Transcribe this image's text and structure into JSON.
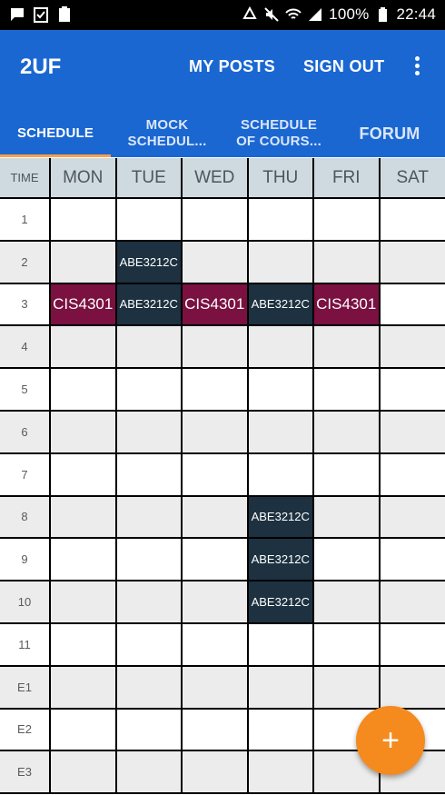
{
  "statusbar": {
    "battery_text": "100%",
    "time": "22:44",
    "left_icons": [
      "chat-icon",
      "clipboard-check-icon",
      "battery-saver-icon"
    ],
    "right_icons": [
      "recycle-icon",
      "mute-icon",
      "wifi-icon",
      "signal-icon",
      "battery-icon"
    ]
  },
  "appbar": {
    "title": "2UF",
    "my_posts": "MY POSTS",
    "sign_out": "SIGN OUT",
    "color": "#1a67d2"
  },
  "tabs": [
    {
      "label": "SCHEDULE",
      "active": true
    },
    {
      "label": "MOCK\nSCHEDUL...",
      "active": false
    },
    {
      "label": "SCHEDULE\nOF COURS...",
      "active": false
    },
    {
      "label": "FORUM",
      "active": false
    }
  ],
  "schedule": {
    "header": [
      "TIME",
      "MON",
      "TUE",
      "WED",
      "THU",
      "FRI",
      "SAT"
    ],
    "rows": [
      {
        "time": "1",
        "cells": [
          "",
          "",
          "",
          "",
          "",
          ""
        ]
      },
      {
        "time": "2",
        "cells": [
          "",
          "ABE3212C",
          "",
          "",
          "",
          ""
        ]
      },
      {
        "time": "3",
        "cells": [
          "CIS4301",
          "ABE3212C",
          "CIS4301",
          "ABE3212C",
          "CIS4301",
          ""
        ]
      },
      {
        "time": "4",
        "cells": [
          "",
          "",
          "",
          "",
          "",
          ""
        ]
      },
      {
        "time": "5",
        "cells": [
          "",
          "",
          "",
          "",
          "",
          ""
        ]
      },
      {
        "time": "6",
        "cells": [
          "",
          "",
          "",
          "",
          "",
          ""
        ]
      },
      {
        "time": "7",
        "cells": [
          "",
          "",
          "",
          "",
          "",
          ""
        ]
      },
      {
        "time": "8",
        "cells": [
          "",
          "",
          "",
          "ABE3212C",
          "",
          ""
        ]
      },
      {
        "time": "9",
        "cells": [
          "",
          "",
          "",
          "ABE3212C",
          "",
          ""
        ]
      },
      {
        "time": "10",
        "cells": [
          "",
          "",
          "",
          "ABE3212C",
          "",
          ""
        ]
      },
      {
        "time": "11",
        "cells": [
          "",
          "",
          "",
          "",
          "",
          ""
        ]
      },
      {
        "time": "E1",
        "cells": [
          "",
          "",
          "",
          "",
          "",
          ""
        ]
      },
      {
        "time": "E2",
        "cells": [
          "",
          "",
          "",
          "",
          "",
          ""
        ]
      },
      {
        "time": "E3",
        "cells": [
          "",
          "",
          "",
          "",
          "",
          ""
        ]
      }
    ],
    "course_colors": {
      "CIS4301": "#7a1140",
      "ABE3212C": "#1d3140"
    }
  },
  "fab": {
    "icon": "plus-icon",
    "label": "+",
    "color": "#f58a1f"
  }
}
